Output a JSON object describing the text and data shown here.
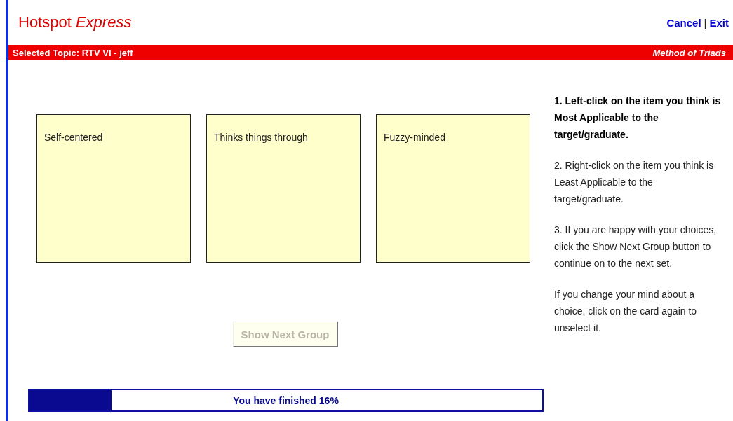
{
  "header": {
    "title": "Hotspot *Express*",
    "links": [
      "Cancel",
      "Exit"
    ],
    "separator": "|"
  },
  "topic_bar": {
    "topic": "Selected Topic:  RTV VI - jeff",
    "method": "Method of Triads"
  },
  "cards": [
    {
      "label": "Self-centered",
      "selected": false
    },
    {
      "label": "Thinks things through",
      "selected": false
    },
    {
      "label": "Fuzzy-minded",
      "selected": false
    }
  ],
  "next_button": {
    "label": "Show Next Group",
    "disabled": true
  },
  "instructions": [
    {
      "text": "1. Left-click on the item you think is Most Applicable to the target/graduate.",
      "bold": true
    },
    {
      "text": "2. Right-click  on the item  you think  is Least Applicable  to the target/graduate.",
      "bold": false
    },
    {
      "text": "3. If you are happy with your choices,  click the Show Next Group button  to continue  on to the next set.",
      "bold": false
    },
    {
      "text": "If you change your mind  about a choice,  click on the card again to unselect  it.",
      "bold": false
    }
  ],
  "progress": {
    "level": 0.16,
    "label": "You have finished 16%"
  }
}
